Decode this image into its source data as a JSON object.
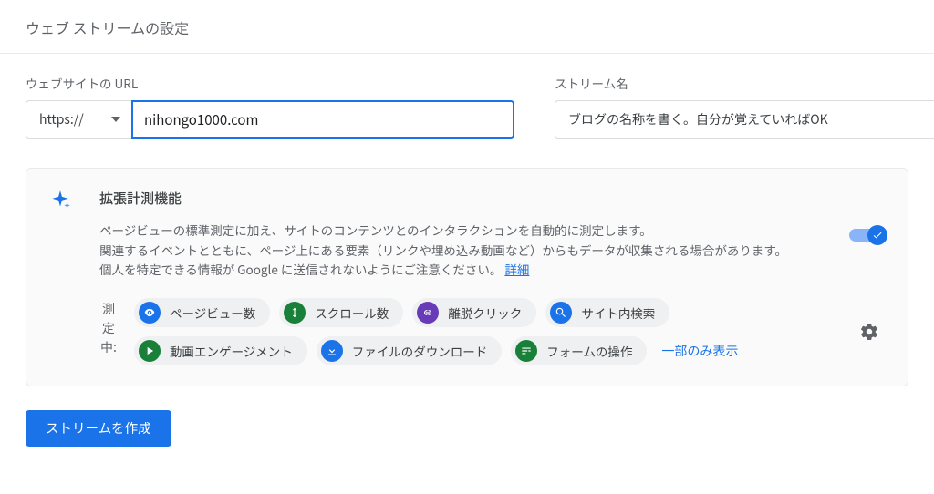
{
  "header": {
    "title": "ウェブ ストリームの設定"
  },
  "fields": {
    "url_label": "ウェブサイトの URL",
    "protocol_value": "https://",
    "url_value": "nihongo1000.com",
    "stream_label": "ストリーム名",
    "stream_value": "ブログの名称を書く。自分が覚えていればOK"
  },
  "enhanced": {
    "title": "拡張計測機能",
    "desc_line1": "ページビューの標準測定に加え、サイトのコンテンツとのインタラクションを自動的に測定します。",
    "desc_line2_a": "関連するイベントとともに、ページ上にある要素（リンクや埋め込み動画など）からもデータが収集される場合があります。個人を特定できる情報が Google に送信されないようにご注意ください。",
    "details_link": "詳細",
    "measuring_label": "測定中:",
    "chips": [
      {
        "label": "ページビュー数",
        "icon": "eye-icon",
        "color": "ci-blue"
      },
      {
        "label": "スクロール数",
        "icon": "scroll-icon",
        "color": "ci-green"
      },
      {
        "label": "離脱クリック",
        "icon": "link-icon",
        "color": "ci-purple"
      },
      {
        "label": "サイト内検索",
        "icon": "search-icon",
        "color": "ci-blue"
      },
      {
        "label": "動画エンゲージメント",
        "icon": "play-icon",
        "color": "ci-green"
      },
      {
        "label": "ファイルのダウンロード",
        "icon": "download-icon",
        "color": "ci-blue"
      },
      {
        "label": "フォームの操作",
        "icon": "form-icon",
        "color": "ci-green"
      }
    ],
    "partial_display": "一部のみ表示",
    "toggle_on": true
  },
  "actions": {
    "create_stream": "ストリームを作成"
  }
}
